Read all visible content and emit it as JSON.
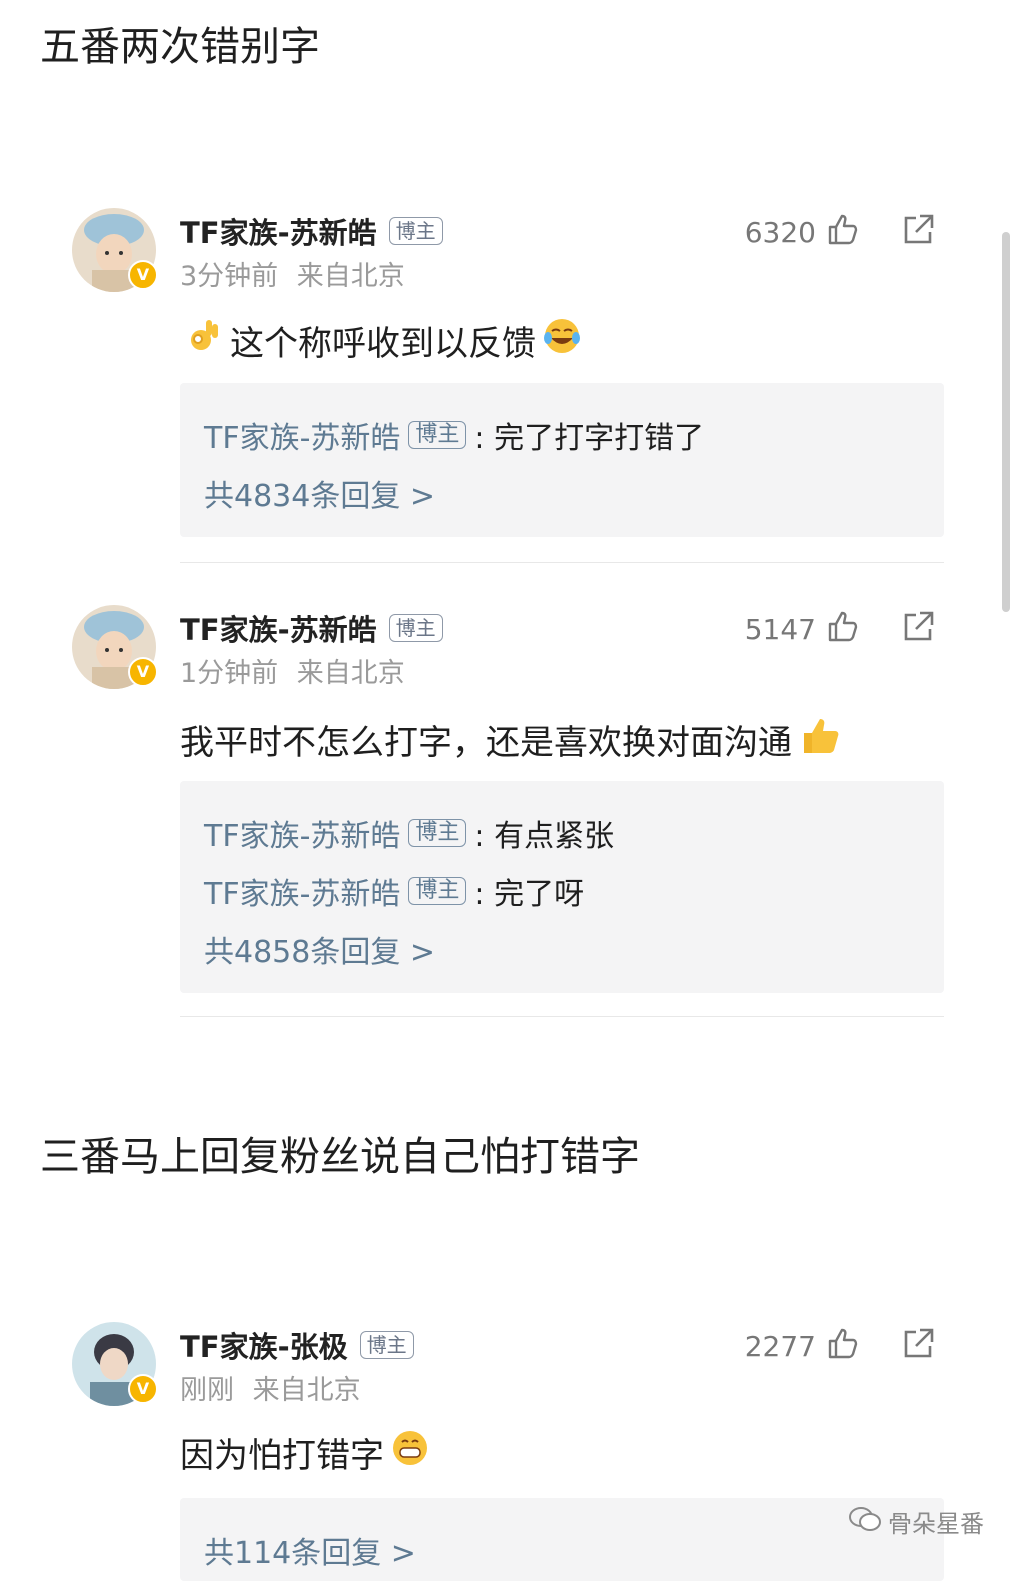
{
  "captions": {
    "top": "五番两次错别字",
    "middle": "三番马上回复粉丝说自己怕打错字"
  },
  "comments": [
    {
      "author": "TF家族-苏新皓",
      "tag": "博主",
      "time": "3分钟前",
      "location": "来自北京",
      "likes": "6320",
      "text": "这个称呼收到以反馈",
      "replies": [
        {
          "author": "TF家族-苏新皓",
          "tag": "博主",
          "text": ": 完了打字打错了"
        }
      ],
      "reply_count": "共4834条回复 >"
    },
    {
      "author": "TF家族-苏新皓",
      "tag": "博主",
      "time": "1分钟前",
      "location": "来自北京",
      "likes": "5147",
      "text": "我平时不怎么打字，还是喜欢换对面沟通",
      "replies": [
        {
          "author": "TF家族-苏新皓",
          "tag": "博主",
          "text": ": 有点紧张"
        },
        {
          "author": "TF家族-苏新皓",
          "tag": "博主",
          "text": ": 完了呀"
        }
      ],
      "reply_count": "共4858条回复 >"
    },
    {
      "author": "TF家族-张极",
      "tag": "博主",
      "time": "刚刚",
      "location": "来自北京",
      "likes": "2277",
      "text": "因为怕打错字",
      "replies": [],
      "reply_count": "共114条回复 >"
    }
  ],
  "watermark": "骨朵星番",
  "icons": {
    "like": "thumbs-up-icon",
    "share": "share-icon",
    "verified": "verified-badge-icon"
  },
  "colors": {
    "reply_name": "#5e7a92",
    "badge": "#f7b500",
    "reply_bg": "#f4f4f5"
  }
}
